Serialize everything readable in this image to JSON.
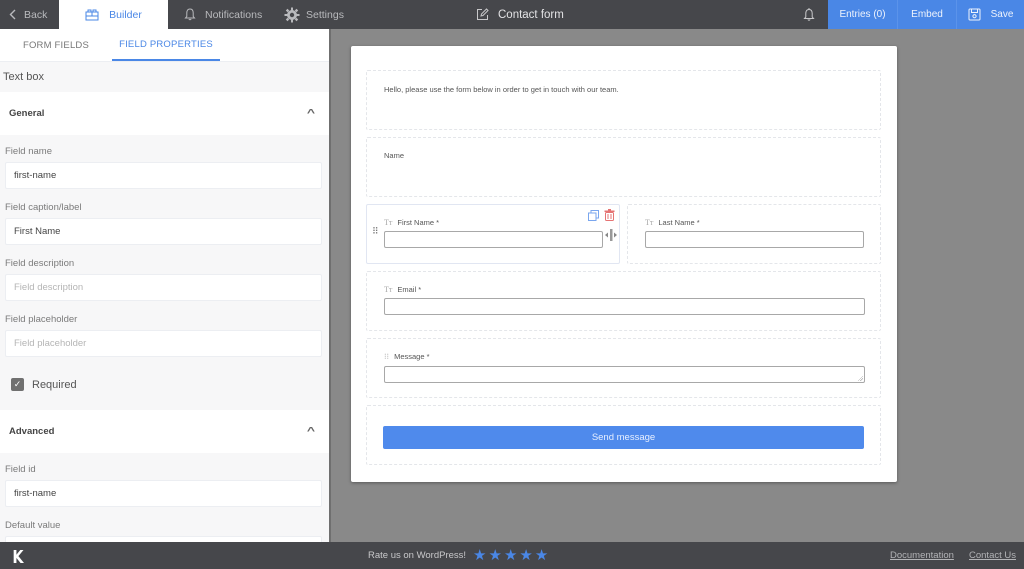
{
  "topbar": {
    "back_label": "Back",
    "builder_label": "Builder",
    "notifications_label": "Notifications",
    "settings_label": "Settings",
    "form_title": "Contact form",
    "entries_label": "Entries (0)",
    "embed_label": "Embed",
    "save_label": "Save"
  },
  "sidebar": {
    "tabs": [
      {
        "label": "FORM FIELDS",
        "active": false
      },
      {
        "label": "FIELD PROPERTIES",
        "active": true
      }
    ],
    "field_type": "Text box",
    "general": {
      "title": "General",
      "field_name_label": "Field name",
      "field_name_value": "first-name",
      "caption_label": "Field caption/label",
      "caption_value": "First Name",
      "description_label": "Field description",
      "description_placeholder": "Field description",
      "placeholder_label": "Field placeholder",
      "placeholder_placeholder": "Field placeholder",
      "required_label": "Required",
      "required_checked": true
    },
    "advanced": {
      "title": "Advanced",
      "field_id_label": "Field id",
      "field_id_value": "first-name",
      "default_value_label": "Default value"
    }
  },
  "form": {
    "intro_text": "Hello, please use the form below in order to get in touch with our team.",
    "name_heading": "Name",
    "fields": [
      {
        "label": "First Name *",
        "type": "text"
      },
      {
        "label": "Last Name *",
        "type": "text"
      },
      {
        "label": "Email *",
        "type": "text"
      },
      {
        "label": "Message *",
        "type": "textarea"
      }
    ],
    "submit_label": "Send message"
  },
  "footer": {
    "logo": "K",
    "rate_text": "Rate us on WordPress!",
    "stars": 5,
    "documentation_label": "Documentation",
    "contact_label": "Contact Us"
  },
  "colors": {
    "accent": "#4a87e6",
    "topbar_bg": "#46474b",
    "canvas_bg": "#898989",
    "delete_red": "#e57373"
  }
}
